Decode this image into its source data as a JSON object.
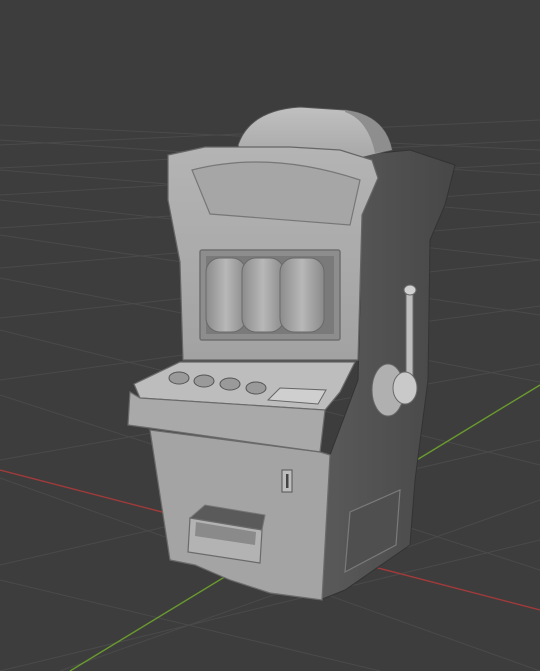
{
  "viewport": {
    "background_color": "#3d3d3d",
    "grid_line_color": "#4a4a4a",
    "x_axis_color": "#a33a3a",
    "y_axis_color": "#6a9a2e",
    "model_base_color": "#9a9a9a",
    "model_highlight_color": "#cfcfcf",
    "model_shadow_color": "#4a4a4a"
  },
  "model": {
    "name_icon": "slot-machine-icon",
    "parts": [
      "marquee",
      "reel-window",
      "reel-1",
      "reel-2",
      "reel-3",
      "control-panel",
      "button-1",
      "button-2",
      "button-3",
      "button-4",
      "bill-acceptor-slot",
      "coin-slot",
      "coin-tray",
      "side-lever",
      "lever-knob",
      "service-door"
    ]
  }
}
